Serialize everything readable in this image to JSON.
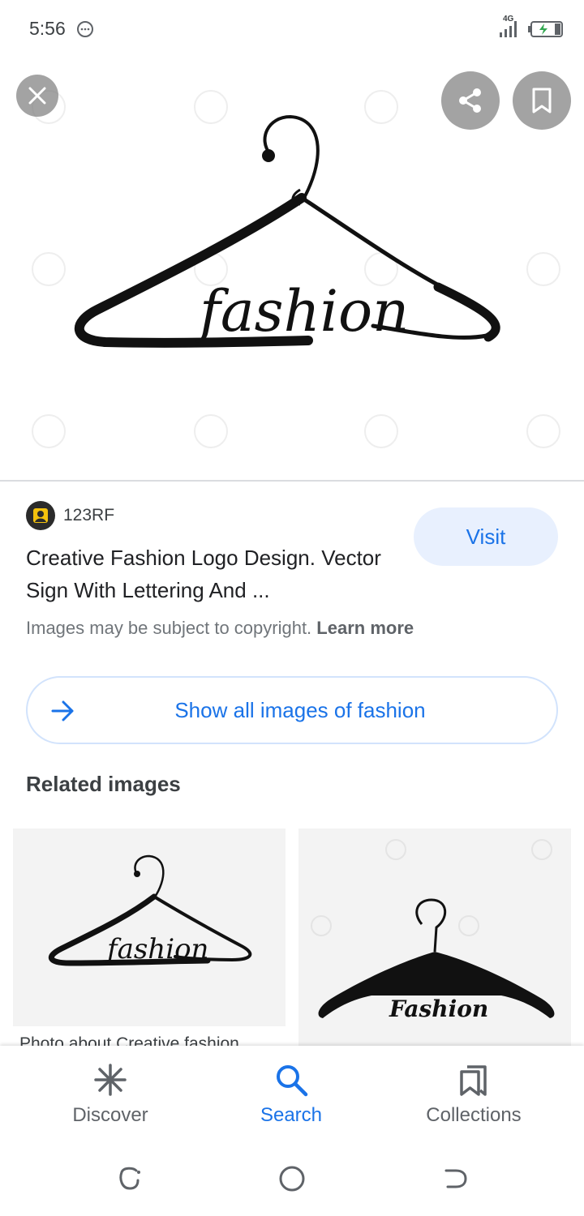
{
  "status_bar": {
    "time": "5:56",
    "network": "4G",
    "icons": [
      "message-icon",
      "signal-icon",
      "battery-charging-icon"
    ]
  },
  "hero": {
    "logo_text": "fashion",
    "actions": [
      "close-icon",
      "share-icon",
      "bookmark-icon"
    ]
  },
  "source": {
    "name": "123RF",
    "favicon": "123rf-favicon",
    "visit_label": "Visit"
  },
  "image_title": "Creative Fashion Logo Design. Vector Sign With Lettering And ...",
  "copyright": {
    "text": "Images may be subject to copyright.",
    "learn_more": "Learn more"
  },
  "show_all_label": "Show all images of fashion",
  "related": {
    "heading": "Related images",
    "items": [
      {
        "logo_text": "fashion",
        "caption": "Photo about Creative fashion"
      },
      {
        "logo_text": "Fashion",
        "caption": ""
      }
    ]
  },
  "bottom_nav": {
    "items": [
      {
        "label": "Discover",
        "icon": "asterisk-icon",
        "active": false
      },
      {
        "label": "Search",
        "icon": "search-icon",
        "active": true
      },
      {
        "label": "Collections",
        "icon": "collections-icon",
        "active": false
      }
    ]
  },
  "colors": {
    "accent": "#1a73e8",
    "accent_light": "#e8f0fe",
    "text_primary": "#202124",
    "text_secondary": "#70757a"
  }
}
